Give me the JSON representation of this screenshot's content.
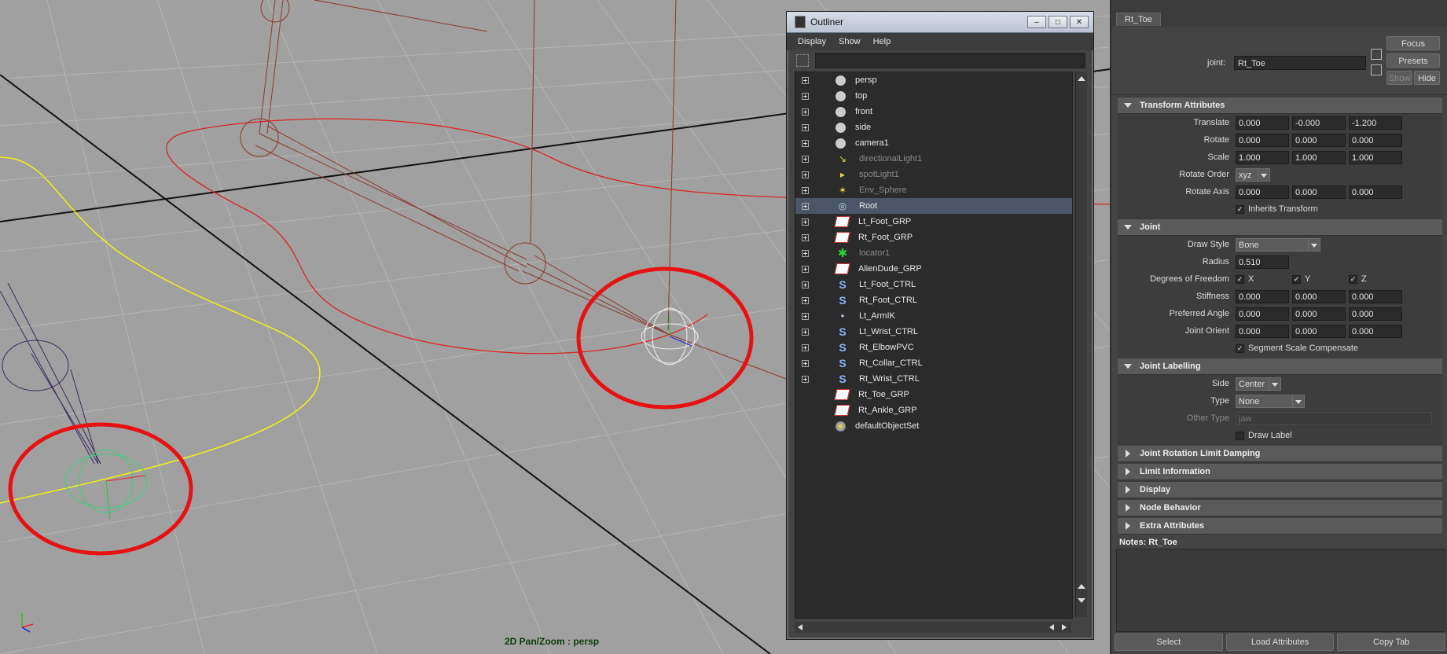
{
  "viewport": {
    "hud_label": "2D Pan/Zoom : persp"
  },
  "outliner": {
    "title": "Outliner",
    "menus": [
      "Display",
      "Show",
      "Help"
    ],
    "items": [
      {
        "label": "persp",
        "icon": "camera-icon",
        "expandable": true,
        "dim": false,
        "selected": false
      },
      {
        "label": "top",
        "icon": "camera-icon",
        "expandable": true,
        "dim": false,
        "selected": false
      },
      {
        "label": "front",
        "icon": "camera-icon",
        "expandable": true,
        "dim": false,
        "selected": false
      },
      {
        "label": "side",
        "icon": "camera-icon",
        "expandable": true,
        "dim": false,
        "selected": false
      },
      {
        "label": "camera1",
        "icon": "camera-icon",
        "expandable": true,
        "dim": false,
        "selected": false
      },
      {
        "label": "directionalLight1",
        "icon": "directional-light-icon",
        "expandable": true,
        "dim": true,
        "selected": false
      },
      {
        "label": "spotLight1",
        "icon": "spot-light-icon",
        "expandable": true,
        "dim": true,
        "selected": false
      },
      {
        "label": "Env_Sphere",
        "icon": "env-sphere-icon",
        "expandable": true,
        "dim": true,
        "selected": false
      },
      {
        "label": "Root",
        "icon": "joint-icon",
        "expandable": true,
        "dim": false,
        "selected": true
      },
      {
        "label": "Lt_Foot_GRP",
        "icon": "group-icon",
        "expandable": true,
        "dim": false,
        "selected": false
      },
      {
        "label": "Rt_Foot_GRP",
        "icon": "group-icon",
        "expandable": true,
        "dim": false,
        "selected": false
      },
      {
        "label": "locator1",
        "icon": "locator-icon",
        "expandable": true,
        "dim": true,
        "selected": false
      },
      {
        "label": "AlienDude_GRP",
        "icon": "group-icon",
        "expandable": true,
        "dim": false,
        "selected": false
      },
      {
        "label": "Lt_Foot_CTRL",
        "icon": "curve-icon",
        "expandable": true,
        "dim": false,
        "selected": false
      },
      {
        "label": "Rt_Foot_CTRL",
        "icon": "curve-icon",
        "expandable": true,
        "dim": false,
        "selected": false
      },
      {
        "label": "Lt_ArmIK",
        "icon": "ik-handle-icon",
        "expandable": true,
        "dim": false,
        "selected": false
      },
      {
        "label": "Lt_Wrist_CTRL",
        "icon": "curve-icon",
        "expandable": true,
        "dim": false,
        "selected": false
      },
      {
        "label": "Rt_ElbowPVC",
        "icon": "curve-icon",
        "expandable": true,
        "dim": false,
        "selected": false
      },
      {
        "label": "Rt_Collar_CTRL",
        "icon": "curve-icon",
        "expandable": true,
        "dim": false,
        "selected": false
      },
      {
        "label": "Rt_Wrist_CTRL",
        "icon": "curve-icon",
        "expandable": true,
        "dim": false,
        "selected": false
      },
      {
        "label": "Rt_Toe_GRP",
        "icon": "group-icon",
        "expandable": false,
        "dim": false,
        "selected": false
      },
      {
        "label": "Rt_Ankle_GRP",
        "icon": "group-icon",
        "expandable": false,
        "dim": false,
        "selected": false
      },
      {
        "label": "defaultObjectSet",
        "icon": "set-icon",
        "expandable": false,
        "dim": false,
        "selected": false
      }
    ]
  },
  "attribute_editor": {
    "tab": "Rt_Toe",
    "node_type_label": "joint:",
    "node_name": "Rt_Toe",
    "buttons": {
      "focus": "Focus",
      "presets": "Presets",
      "show": "Show",
      "hide": "Hide"
    },
    "transform": {
      "title": "Transform Attributes",
      "translate": {
        "label": "Translate",
        "values": [
          "0.000",
          "-0.000",
          "-1.200"
        ]
      },
      "rotate": {
        "label": "Rotate",
        "values": [
          "0.000",
          "0.000",
          "0.000"
        ]
      },
      "scale": {
        "label": "Scale",
        "values": [
          "1.000",
          "1.000",
          "1.000"
        ]
      },
      "rotate_order": {
        "label": "Rotate Order",
        "value": "xyz"
      },
      "rotate_axis": {
        "label": "Rotate Axis",
        "values": [
          "0.000",
          "0.000",
          "0.000"
        ]
      },
      "inherits": {
        "label": "Inherits Transform",
        "checked": true
      }
    },
    "joint": {
      "title": "Joint",
      "draw_style": {
        "label": "Draw Style",
        "value": "Bone"
      },
      "radius": {
        "label": "Radius",
        "value": "0.510"
      },
      "dof": {
        "label": "Degrees of Freedom",
        "x": "X",
        "y": "Y",
        "z": "Z"
      },
      "stiffness": {
        "label": "Stiffness",
        "values": [
          "0.000",
          "0.000",
          "0.000"
        ]
      },
      "preferred_angle": {
        "label": "Preferred Angle",
        "values": [
          "0.000",
          "0.000",
          "0.000"
        ]
      },
      "joint_orient": {
        "label": "Joint Orient",
        "values": [
          "0.000",
          "0.000",
          "0.000"
        ]
      },
      "ssc": {
        "label": "Segment Scale Compensate",
        "checked": true
      }
    },
    "labelling": {
      "title": "Joint Labelling",
      "side": {
        "label": "Side",
        "value": "Center"
      },
      "type": {
        "label": "Type",
        "value": "None"
      },
      "other_type": {
        "label": "Other Type",
        "value": "jaw"
      },
      "draw_label": {
        "label": "Draw Label",
        "checked": false
      }
    },
    "closed_sections": [
      "Joint Rotation Limit Damping",
      "Limit Information",
      "Display",
      "Node Behavior",
      "Extra Attributes"
    ],
    "notes_label": "Notes:  Rt_Toe",
    "bottom_buttons": {
      "select": "Select",
      "load": "Load Attributes",
      "copy": "Copy Tab"
    }
  }
}
